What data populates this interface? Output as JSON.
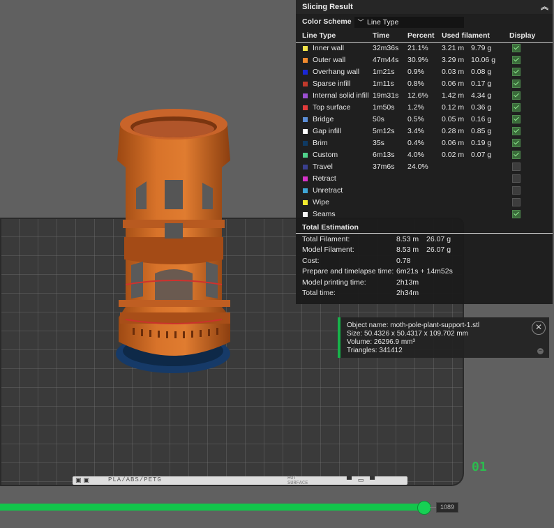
{
  "viewport": {
    "plate_number": "01",
    "filament_label": "PLA/ABS/PETG",
    "surface_label_line1": "HOT",
    "surface_label_line2": "SURFACE",
    "layer_value": "1089"
  },
  "slicing_result": {
    "title": "Slicing Result",
    "color_scheme_label": "Color Scheme",
    "color_scheme_value": "Line Type",
    "columns": [
      "Line Type",
      "Time",
      "Percent",
      "Used filament",
      "Display"
    ],
    "rows": [
      {
        "type": "Inner wall",
        "time": "32m36s",
        "percent": "21.1%",
        "meters": "3.21 m",
        "grams": "9.79 g",
        "display": true,
        "color": "#f2e44a"
      },
      {
        "type": "Outer wall",
        "time": "47m44s",
        "percent": "30.9%",
        "meters": "3.29 m",
        "grams": "10.06 g",
        "display": true,
        "color": "#f28a2e"
      },
      {
        "type": "Overhang wall",
        "time": "1m21s",
        "percent": "0.9%",
        "meters": "0.03 m",
        "grams": "0.08 g",
        "display": true,
        "color": "#1a27d6"
      },
      {
        "type": "Sparse infill",
        "time": "1m11s",
        "percent": "0.8%",
        "meters": "0.06 m",
        "grams": "0.17 g",
        "display": true,
        "color": "#c0392b"
      },
      {
        "type": "Internal solid infill",
        "time": "19m31s",
        "percent": "12.6%",
        "meters": "1.42 m",
        "grams": "4.34 g",
        "display": true,
        "color": "#9b4fd1"
      },
      {
        "type": "Top surface",
        "time": "1m50s",
        "percent": "1.2%",
        "meters": "0.12 m",
        "grams": "0.36 g",
        "display": true,
        "color": "#e23b3b"
      },
      {
        "type": "Bridge",
        "time": "50s",
        "percent": "0.5%",
        "meters": "0.05 m",
        "grams": "0.16 g",
        "display": true,
        "color": "#5b8dd6"
      },
      {
        "type": "Gap infill",
        "time": "5m12s",
        "percent": "3.4%",
        "meters": "0.28 m",
        "grams": "0.85 g",
        "display": true,
        "color": "#ffffff"
      },
      {
        "type": "Brim",
        "time": "35s",
        "percent": "0.4%",
        "meters": "0.06 m",
        "grams": "0.19 g",
        "display": true,
        "color": "#0f3a63"
      },
      {
        "type": "Custom",
        "time": "6m13s",
        "percent": "4.0%",
        "meters": "0.02 m",
        "grams": "0.07 g",
        "display": true,
        "color": "#4fd18a"
      },
      {
        "type": "Travel",
        "time": "37m6s",
        "percent": "24.0%",
        "meters": "",
        "grams": "",
        "display": false,
        "color": "#3a3f8f"
      },
      {
        "type": "Retract",
        "time": "",
        "percent": "",
        "meters": "",
        "grams": "",
        "display": false,
        "color": "#d633c9"
      },
      {
        "type": "Unretract",
        "time": "",
        "percent": "",
        "meters": "",
        "grams": "",
        "display": false,
        "color": "#3fa6d6"
      },
      {
        "type": "Wipe",
        "time": "",
        "percent": "",
        "meters": "",
        "grams": "",
        "display": false,
        "color": "#f2ea2e"
      },
      {
        "type": "Seams",
        "time": "",
        "percent": "",
        "meters": "",
        "grams": "",
        "display": true,
        "color": "#f5f5f5"
      }
    ],
    "total_estimation": {
      "title": "Total Estimation",
      "rows": [
        {
          "label": "Total Filament:",
          "v1": "8.53 m",
          "v2": "26.07 g"
        },
        {
          "label": "Model Filament:",
          "v1": "8.53 m",
          "v2": "26.07 g"
        },
        {
          "label": "Cost:",
          "v1": "0.78",
          "v2": ""
        },
        {
          "label": "Prepare and timelapse time:",
          "v1": "6m21s + 14m52s",
          "v2": ""
        },
        {
          "label": "Model printing time:",
          "v1": "2h13m",
          "v2": ""
        },
        {
          "label": "Total time:",
          "v1": "2h34m",
          "v2": ""
        }
      ]
    }
  },
  "object_info": {
    "name": "Object name: moth-pole-plant-support-1.stl",
    "size": "Size: 50.4326 x 50.4317 x 109.702 mm",
    "volume": "Volume: 26296.9 mm³",
    "triangles": "Triangles: 341412"
  }
}
